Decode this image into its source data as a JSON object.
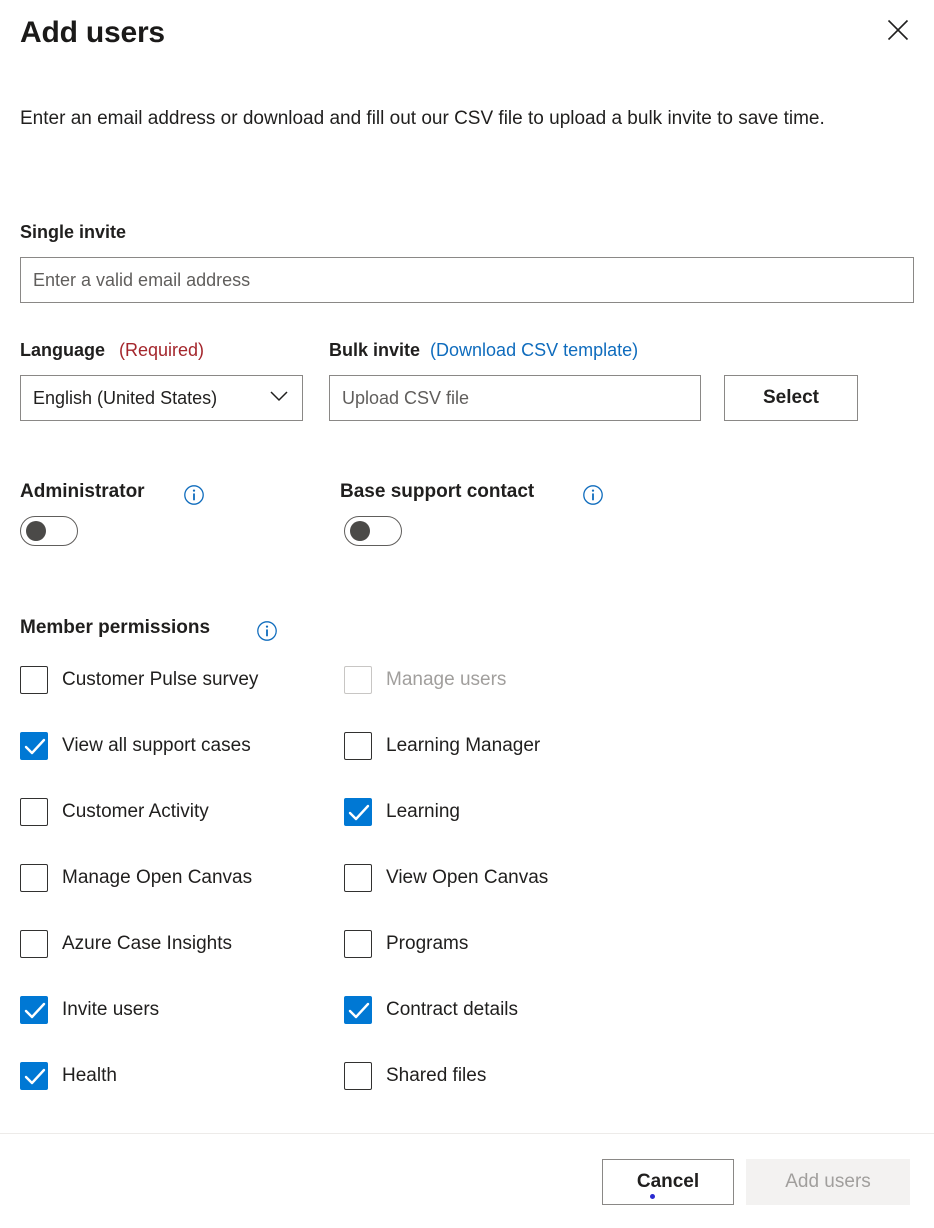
{
  "dialog": {
    "title": "Add users",
    "close_icon": "close-icon",
    "description": "Enter an email address or download and fill out our CSV file to upload a bulk invite to save time."
  },
  "single_invite": {
    "label": "Single invite",
    "placeholder": "Enter a valid email address",
    "value": ""
  },
  "language": {
    "label": "Language",
    "required_tag": "(Required)",
    "selected": "English (United States)",
    "chevron_icon": "chevron-down-icon",
    "options": [
      "English (United States)"
    ]
  },
  "bulk_invite": {
    "label": "Bulk invite",
    "download_link": "(Download CSV template)",
    "placeholder": "Upload CSV file",
    "value": "",
    "select_button": "Select"
  },
  "toggles": [
    {
      "label": "Administrator",
      "state": "off",
      "info_icon": "info-icon"
    },
    {
      "label": "Base support contact",
      "state": "off",
      "info_icon": "info-icon"
    }
  ],
  "member_permissions": {
    "heading": "Member permissions",
    "info_icon": "info-icon",
    "check_icon": "check-icon",
    "rows": [
      {
        "left": {
          "label": "Customer Pulse survey",
          "checked": false,
          "disabled": false
        },
        "right": {
          "label": "Manage users",
          "checked": false,
          "disabled": true
        }
      },
      {
        "left": {
          "label": "View all support cases",
          "checked": true,
          "disabled": false
        },
        "right": {
          "label": "Learning Manager",
          "checked": false,
          "disabled": false
        }
      },
      {
        "left": {
          "label": "Customer Activity",
          "checked": false,
          "disabled": false
        },
        "right": {
          "label": "Learning",
          "checked": true,
          "disabled": false
        }
      },
      {
        "left": {
          "label": "Manage Open Canvas",
          "checked": false,
          "disabled": false
        },
        "right": {
          "label": "View Open Canvas",
          "checked": false,
          "disabled": false
        }
      },
      {
        "left": {
          "label": "Azure Case Insights",
          "checked": false,
          "disabled": false
        },
        "right": {
          "label": "Programs",
          "checked": false,
          "disabled": false
        }
      },
      {
        "left": {
          "label": "Invite users",
          "checked": true,
          "disabled": false
        },
        "right": {
          "label": "Contract details",
          "checked": true,
          "disabled": false
        }
      },
      {
        "left": {
          "label": "Health",
          "checked": true,
          "disabled": false
        },
        "right": {
          "label": "Shared files",
          "checked": false,
          "disabled": false
        }
      }
    ]
  },
  "footer": {
    "cancel_label": "Cancel",
    "submit_label": "Add users",
    "submit_disabled": true
  },
  "colors": {
    "accent": "#0078d4",
    "link": "#0f6cbd",
    "required": "#a4262c",
    "text": "#201f1e",
    "disabled_text": "#a19f9d",
    "border": "#8a8886",
    "disabled_bg": "#f3f2f1"
  }
}
